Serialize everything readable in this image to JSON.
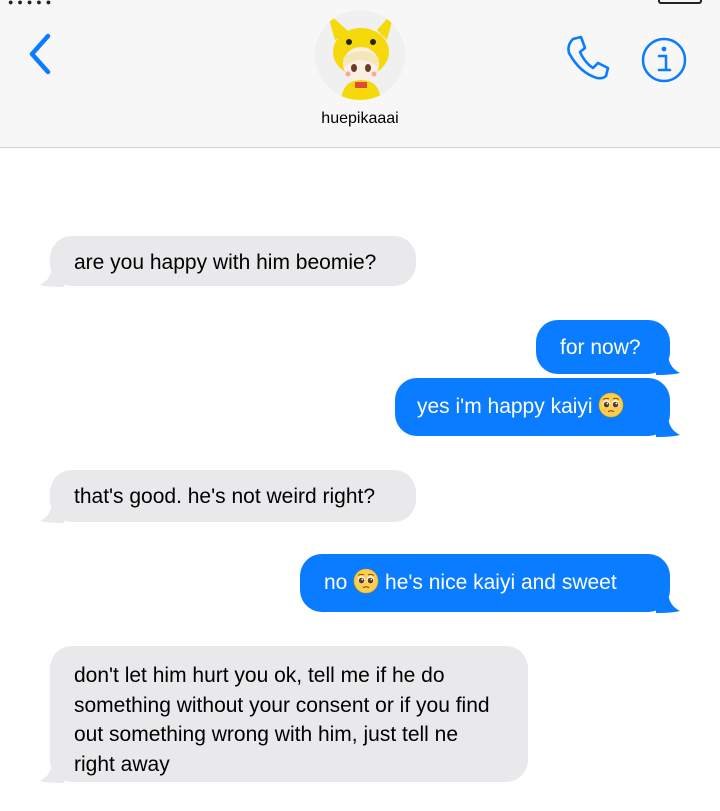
{
  "header": {
    "contact_name": "huepikaaai",
    "avatar_description": "pikachu-hood-avatar"
  },
  "icons": {
    "back": "chevron-left-icon",
    "call": "phone-icon",
    "info": "info-icon",
    "emoji": "pleading-face-emoji"
  },
  "colors": {
    "accent": "#0a7cff",
    "incoming_bubble": "#e9e9eb",
    "outgoing_text": "#ffffff",
    "incoming_text": "#000000",
    "header_bg": "#f7f7f7"
  },
  "messages": [
    {
      "direction": "incoming",
      "text": "are you happy with him beomie?"
    },
    {
      "direction": "outgoing",
      "text": "for now?"
    },
    {
      "direction": "outgoing",
      "text": "yes i'm happy kaiyi",
      "emoji_after": true
    },
    {
      "direction": "incoming",
      "text": "that's good. he's not weird right?"
    },
    {
      "direction": "outgoing",
      "text_before": "no",
      "text_after": "he's nice kaiyi and sweet",
      "emoji_middle": true
    },
    {
      "direction": "incoming",
      "text": "don't let him hurt you ok, tell me if he do something without your consent or if you find out something wrong with him, just tell ne right away"
    }
  ]
}
